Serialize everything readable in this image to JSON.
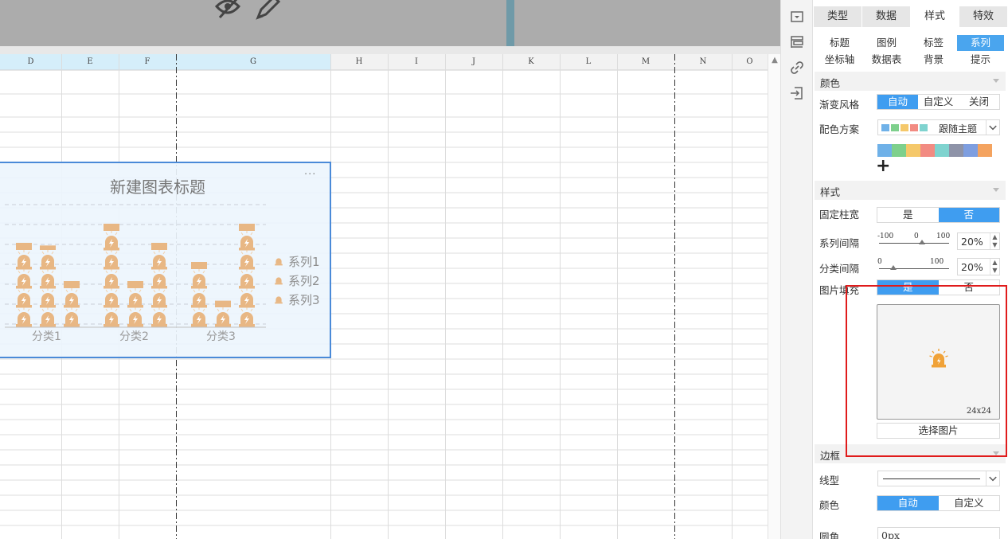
{
  "toolbar": {
    "icons": [
      "hide-icon",
      "edit-icon"
    ]
  },
  "sheet": {
    "columns": [
      "D",
      "E",
      "F",
      "G",
      "H",
      "I",
      "J",
      "K",
      "L",
      "M",
      "N",
      "O"
    ],
    "scroll_up_glyph": "▲"
  },
  "chart": {
    "title": "新建图表标题",
    "more_glyph": "···",
    "categories": [
      "分类1",
      "分类2",
      "分类3"
    ],
    "legend": [
      "系列1",
      "系列2",
      "系列3"
    ],
    "marker_icon": "alarm-light-icon",
    "marker_color": "#e8b784"
  },
  "chart_data": {
    "type": "bar",
    "title": "新建图表标题",
    "categories": [
      "分类1",
      "分类2",
      "分类3"
    ],
    "series": [
      {
        "name": "系列1",
        "values": [
          4.3,
          5.3,
          3.3
        ]
      },
      {
        "name": "系列2",
        "values": [
          4.0,
          2.5,
          1.3
        ]
      },
      {
        "name": "系列3",
        "values": [
          2.5,
          4.5,
          5.3
        ]
      }
    ],
    "legend": "right",
    "grid": true
  },
  "side_icons": [
    "dropdown-icon",
    "layout-icon",
    "link-icon",
    "import-icon"
  ],
  "panel": {
    "main_tabs": [
      "类型",
      "数据",
      "样式",
      "特效"
    ],
    "active_main_tab": "样式",
    "sub_tabs_row1": [
      "标题",
      "图例",
      "标签",
      "系列"
    ],
    "sub_tabs_row2": [
      "坐标轴",
      "数据表",
      "背景",
      "提示"
    ],
    "active_sub_tab": "系列",
    "color_section": "颜色",
    "gradient_label": "渐变风格",
    "gradient_options": [
      "自动",
      "自定义",
      "关闭"
    ],
    "scheme_label": "配色方案",
    "scheme_value": "跟随主题",
    "scheme_swatches": [
      "#6fb1e8",
      "#7ed08c",
      "#f5c86a",
      "#f28b82",
      "#7fd3cf"
    ],
    "palette": [
      "#6fb1e8",
      "#7ed08c",
      "#f5c86a",
      "#f28b82",
      "#7fd3cf",
      "#8e93a8",
      "#7e9ee0",
      "#f4a35f"
    ],
    "add_glyph": "+",
    "style_section": "样式",
    "fixed_width_label": "固定柱宽",
    "yes": "是",
    "no": "否",
    "series_gap_label": "系列间隔",
    "series_gap_ticks": [
      "-100",
      "0",
      "100"
    ],
    "series_gap_value": "20%",
    "category_gap_label": "分类间隔",
    "category_gap_ticks": [
      "0",
      "100"
    ],
    "category_gap_value": "20%",
    "image_fill_label": "图片填充",
    "image_size": "24x24",
    "choose_image": "选择图片",
    "border_section": "边框",
    "line_type_label": "线型",
    "border_color_label": "颜色",
    "border_color_options": [
      "自动",
      "自定义"
    ],
    "corner_label": "圆角",
    "corner_value": "0px",
    "spin_up": "▲",
    "spin_down": "▼"
  }
}
